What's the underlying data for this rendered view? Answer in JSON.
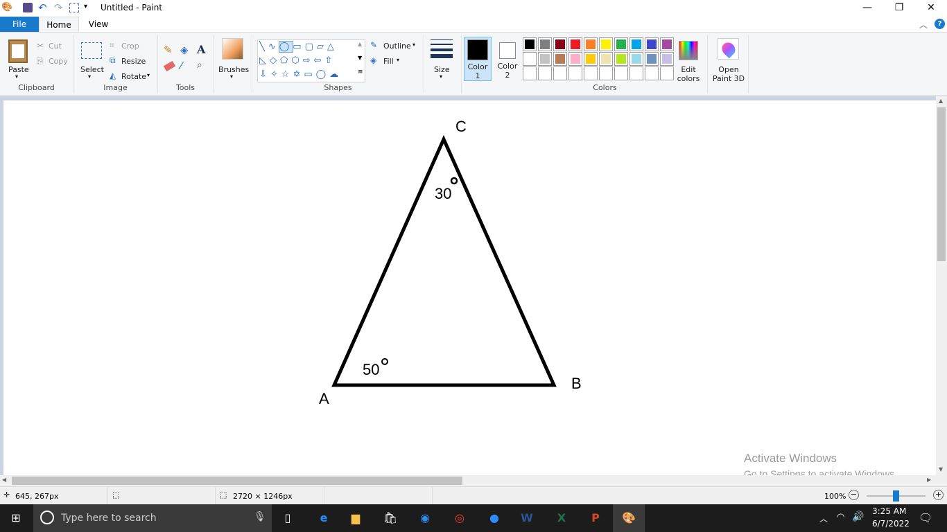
{
  "window": {
    "title": "Untitled - Paint",
    "minimize": "—",
    "restore": "❐",
    "close": "✕"
  },
  "tabs": [
    {
      "label": "File"
    },
    {
      "label": "Home"
    },
    {
      "label": "View"
    }
  ],
  "ribbon": {
    "clipboard": {
      "paste": "Paste",
      "cut": "Cut",
      "copy": "Copy",
      "group": "Clipboard"
    },
    "image": {
      "select": "Select",
      "crop": "Crop",
      "resize": "Resize",
      "rotate": "Rotate",
      "group": "Image"
    },
    "tools": {
      "group": "Tools"
    },
    "brushes": {
      "label": "Brushes"
    },
    "shapes": {
      "outline": "Outline",
      "fill": "Fill",
      "group": "Shapes"
    },
    "size": {
      "label": "Size"
    },
    "colors": {
      "color1": "Color",
      "color1_num": "1",
      "color2": "Color",
      "color2_num": "2",
      "edit1": "Edit",
      "edit2": "colors",
      "group": "Colors",
      "color1_value": "#000000",
      "color2_value": "#ffffff",
      "palette_row1": [
        "#000000",
        "#7f7f7f",
        "#880015",
        "#ed1c24",
        "#ff7f27",
        "#fff200",
        "#22b14c",
        "#00a2e8",
        "#3f48cc",
        "#a349a4"
      ],
      "palette_row2": [
        "#ffffff",
        "#c3c3c3",
        "#b97a57",
        "#ffaec9",
        "#ffc90e",
        "#efe4b0",
        "#b5e61d",
        "#99d9ea",
        "#7092be",
        "#c8bfe7"
      ]
    },
    "paint3d": {
      "line1": "Open",
      "line2": "Paint 3D"
    }
  },
  "drawing": {
    "vertex_a": "A",
    "vertex_b": "B",
    "vertex_c": "C",
    "angle_c": "30",
    "angle_a": "50"
  },
  "watermark": {
    "title": "Activate Windows",
    "subtitle": "Go to Settings to activate Windows."
  },
  "status": {
    "cursor": "645, 267px",
    "canvas_size": "2720 × 1246px",
    "zoom": "100%",
    "zoom_level_percent": 100
  },
  "taskbar": {
    "search_placeholder": "Type here to search",
    "time": "3:25 AM",
    "date": "6/7/2022"
  }
}
